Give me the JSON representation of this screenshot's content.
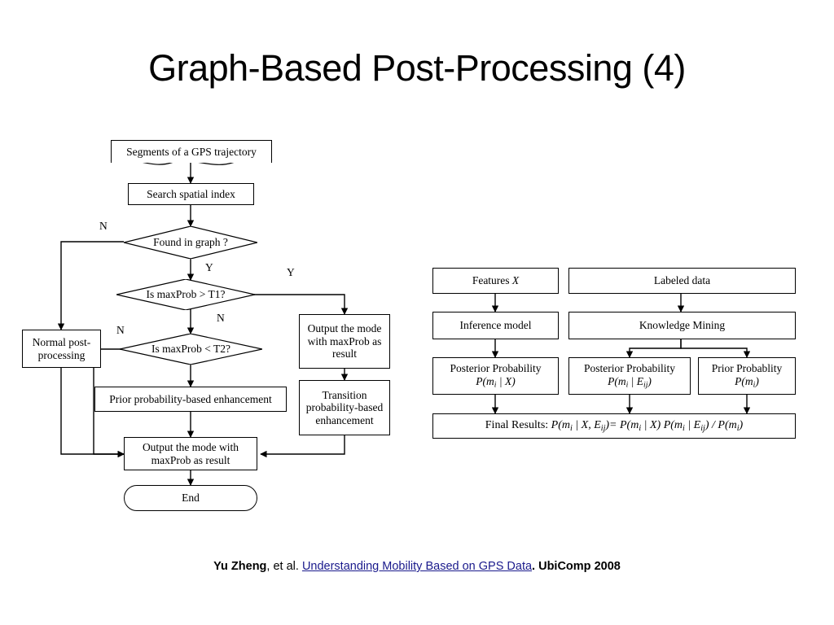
{
  "slide": {
    "title": "Graph-Based Post-Processing (4)",
    "credit": {
      "authors": "Yu Zheng",
      "etal": ", et al. ",
      "paper": "Understanding Mobility Based on GPS Data",
      "venue": ". UbiComp 2008"
    }
  },
  "flowchart": {
    "nodes": {
      "segments": "Segments of a GPS trajectory",
      "search_index": "Search spatial index",
      "found_in_graph": "Found in graph ?",
      "is_maxprob_gt_t1": "Is maxProb > T1?",
      "is_maxprob_lt_t2": "Is maxProb < T2?",
      "normal_post": "Normal post-processing",
      "output_maxprob_result": "Output the mode with maxProb as result",
      "transition_enh": "Transition probability-based enhancement",
      "prior_enh": "Prior probability-based enhancement",
      "output_final": "Output the mode with maxProb as result",
      "end": "End"
    },
    "edge_labels": {
      "n_found": "N",
      "y_found": "Y",
      "y_t1": "Y",
      "n_t1": "N",
      "n_t2": "N"
    }
  },
  "model": {
    "row1": {
      "left": "Features X",
      "right": "Labeled data"
    },
    "row2": {
      "left": "Inference model",
      "right": "Knowledge Mining"
    },
    "row3": {
      "left_title": "Posterior Probability",
      "left_formula": "P(mi | X)",
      "mid_title": "Posterior Probability",
      "mid_formula": "P(mi | Eij)",
      "right_title": "Prior Probablity",
      "right_formula": "P(mi)"
    },
    "final": "Final Results: P(mi | X, Eij)= P(mi | X) P(mi | Eij) / P(mi)",
    "final_prefix": "Final Results: "
  },
  "colors": {
    "line": "#000000",
    "link": "#1a1a8c",
    "background": "#ffffff"
  }
}
